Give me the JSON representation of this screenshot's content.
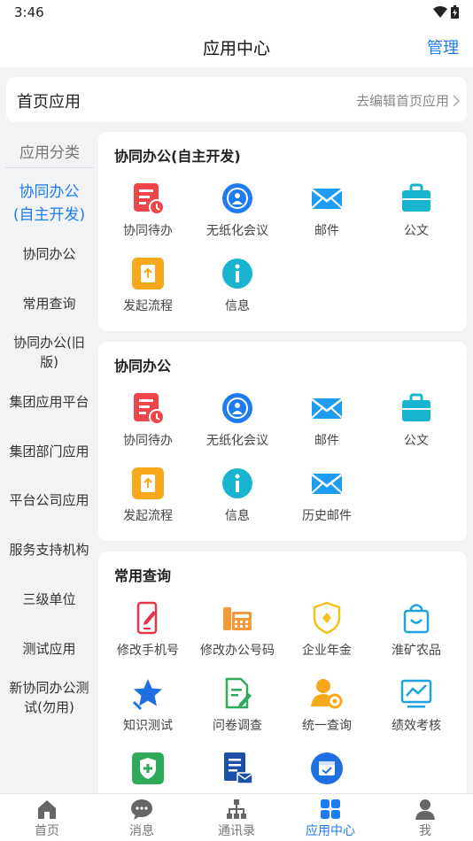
{
  "status": {
    "time": "3:46"
  },
  "header": {
    "title": "应用中心",
    "action": "管理"
  },
  "home_apps": {
    "title": "首页应用",
    "edit_label": "去编辑首页应用"
  },
  "sidebar": {
    "heading": "应用分类",
    "active": [
      "协同办公",
      "(自主开发)"
    ],
    "items": [
      "协同办公",
      "常用查询",
      "协同办公(旧",
      "版)",
      "集团应用平台",
      "集团部门应用",
      "平台公司应用",
      "服务支持机构",
      "三级单位",
      "测试应用",
      "新协同办公测",
      "试(勿用)"
    ]
  },
  "sections": [
    {
      "title": "协同办公(自主开发)",
      "apps": [
        "协同待办",
        "无纸化会议",
        "邮件",
        "公文",
        "发起流程",
        "信息"
      ]
    },
    {
      "title": "协同办公",
      "apps": [
        "协同待办",
        "无纸化会议",
        "邮件",
        "公文",
        "发起流程",
        "信息",
        "历史邮件"
      ]
    },
    {
      "title": "常用查询",
      "apps": [
        "修改手机号",
        "修改办公号码",
        "企业年金",
        "淮矿农品",
        "知识测试",
        "问卷调查",
        "统一查询",
        "绩效考核"
      ]
    }
  ],
  "icons": {
    "todo": "todo-icon",
    "meeting": "paperless-meeting-icon",
    "mail": "mail-icon",
    "doc": "briefcase-icon",
    "flow": "start-flow-icon",
    "info": "info-icon",
    "phone": "phone-edit-icon",
    "officephone": "office-phone-icon",
    "annuity": "shield-annuity-icon",
    "shop": "shopping-bag-icon",
    "quiz": "star-quiz-icon",
    "survey": "survey-icon",
    "query": "person-search-icon",
    "perf": "chart-perf-icon"
  },
  "tabs": [
    "首页",
    "消息",
    "通讯录",
    "应用中心",
    "我"
  ],
  "colors": {
    "accent": "#1e7cf2",
    "red": "#f0454a",
    "orange": "#f7a81b",
    "cyan": "#18b4d0"
  }
}
